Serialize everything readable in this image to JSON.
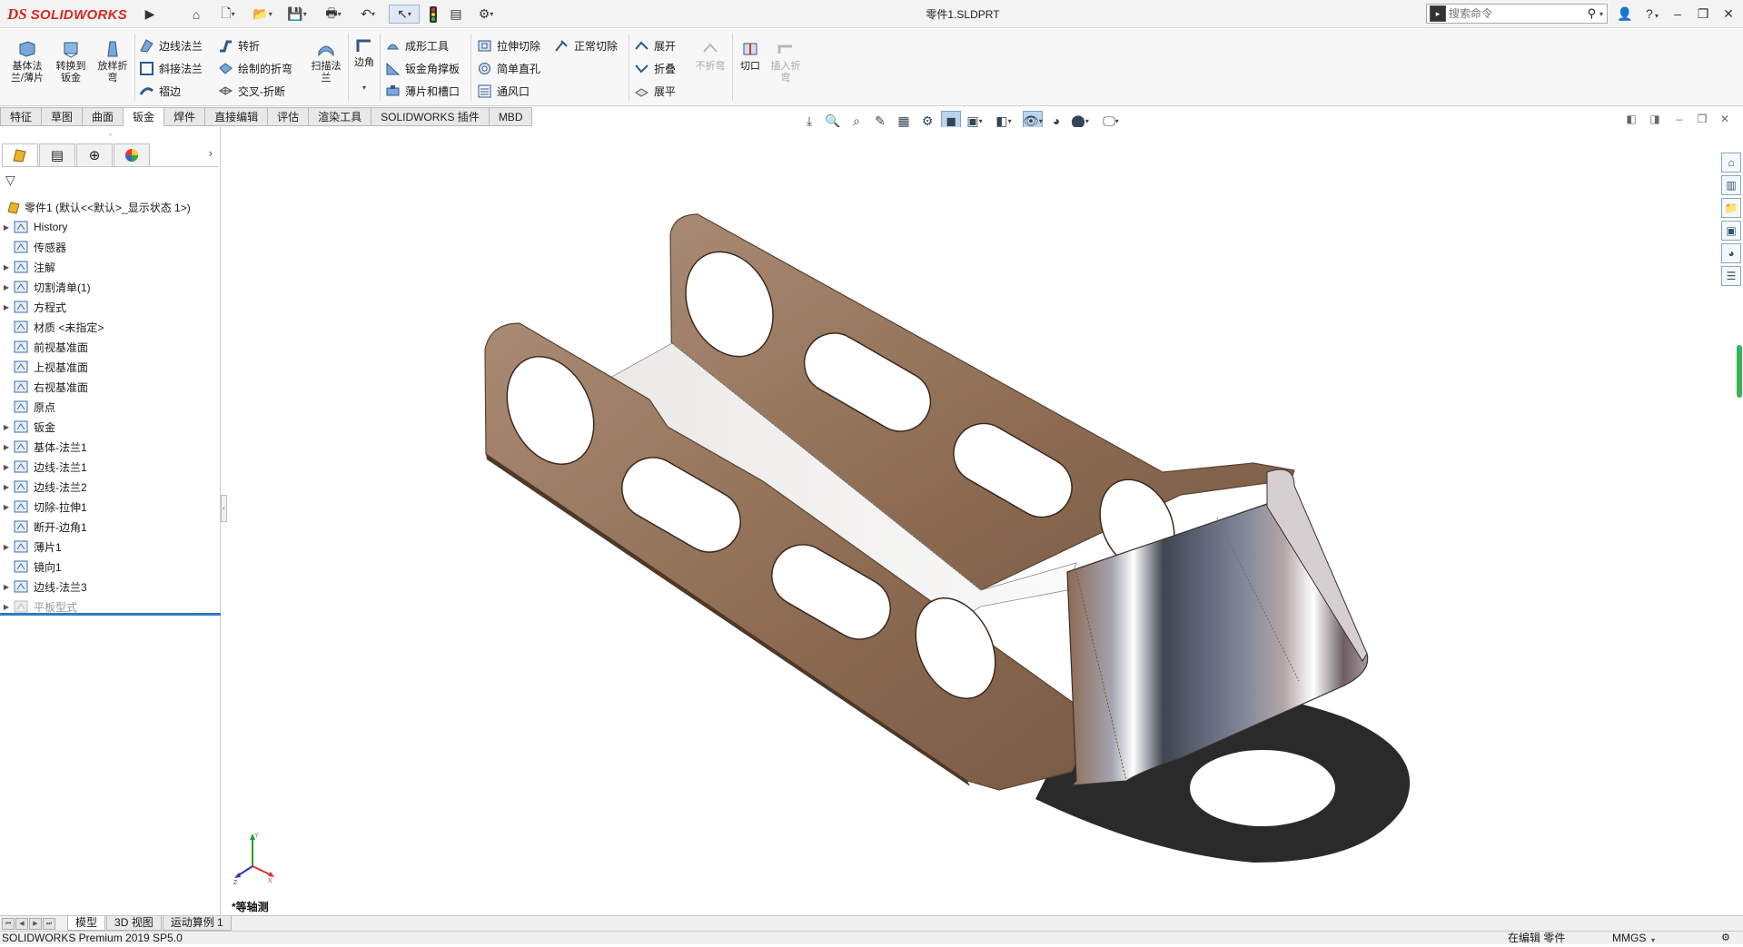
{
  "app": {
    "brand_ds": "DS",
    "brand_name": "SOLIDWORKS",
    "document_title": "零件1.SLDPRT",
    "search_placeholder": "搜索命令"
  },
  "ribbon": {
    "big_buttons": [
      {
        "label": "基体法\n兰/薄片",
        "icon": "base-flange-icon"
      },
      {
        "label": "转换到\n钣金",
        "icon": "convert-to-sheetmetal-icon"
      },
      {
        "label": "放样折\n弯",
        "icon": "lofted-bend-icon"
      }
    ],
    "col1": [
      "边线法兰",
      "斜接法兰",
      "褶边"
    ],
    "col2": [
      "转折",
      "绘制的折弯",
      "交叉-折断"
    ],
    "swept_flange": "扫描法\n兰",
    "corner": "边角",
    "col3": [
      "成形工具",
      "钣金角撑板",
      "薄片和槽口"
    ],
    "col4": [
      "拉伸切除",
      "简单直孔",
      "通风口"
    ],
    "normal_cut": "正常切除",
    "col5": [
      "展开",
      "折叠",
      "展平"
    ],
    "no_bends": "不折弯",
    "rip": "切口",
    "insert_bends": "插入折\n弯"
  },
  "tabs": [
    "特征",
    "草图",
    "曲面",
    "钣金",
    "焊件",
    "直接编辑",
    "评估",
    "渲染工具",
    "SOLIDWORKS 插件",
    "MBD"
  ],
  "active_tab_index": 3,
  "tree": {
    "root": "零件1 (默认<<默认>_显示状态 1>)",
    "items": [
      {
        "label": "History",
        "expandable": true,
        "icon": "history-icon"
      },
      {
        "label": "传感器",
        "expandable": false,
        "icon": "sensor-icon"
      },
      {
        "label": "注解",
        "expandable": true,
        "icon": "annotation-icon"
      },
      {
        "label": "切割清单(1)",
        "expandable": true,
        "icon": "cut-list-icon"
      },
      {
        "label": "方程式",
        "expandable": true,
        "icon": "equation-icon"
      },
      {
        "label": "材质 <未指定>",
        "expandable": false,
        "icon": "material-icon"
      },
      {
        "label": "前视基准面",
        "expandable": false,
        "icon": "plane-icon"
      },
      {
        "label": "上视基准面",
        "expandable": false,
        "icon": "plane-icon"
      },
      {
        "label": "右视基准面",
        "expandable": false,
        "icon": "plane-icon"
      },
      {
        "label": "原点",
        "expandable": false,
        "icon": "origin-icon"
      },
      {
        "label": "钣金",
        "expandable": true,
        "icon": "sheetmetal-folder-icon"
      },
      {
        "label": "基体-法兰1",
        "expandable": true,
        "icon": "flange-feature-icon"
      },
      {
        "label": "边线-法兰1",
        "expandable": true,
        "icon": "edge-flange-icon"
      },
      {
        "label": "边线-法兰2",
        "expandable": true,
        "icon": "edge-flange-icon"
      },
      {
        "label": "切除-拉伸1",
        "expandable": true,
        "icon": "cut-extrude-icon"
      },
      {
        "label": "断开-边角1",
        "expandable": false,
        "icon": "break-corner-icon"
      },
      {
        "label": "薄片1",
        "expandable": true,
        "icon": "tab-feature-icon"
      },
      {
        "label": "镜向1",
        "expandable": false,
        "icon": "mirror-icon"
      },
      {
        "label": "边线-法兰3",
        "expandable": true,
        "icon": "edge-flange-icon"
      },
      {
        "label": "平板型式",
        "expandable": true,
        "icon": "flat-pattern-icon",
        "greyed": true
      }
    ]
  },
  "viewport": {
    "view_name": "*等轴测",
    "triad": {
      "x": "X",
      "y": "Y",
      "z": "Z"
    }
  },
  "bottom_tabs": [
    "模型",
    "3D 视图",
    "运动算例 1"
  ],
  "active_bottom_tab": 0,
  "status": {
    "app_version": "SOLIDWORKS Premium 2019 SP5.0",
    "editing": "在编辑 零件",
    "units": "MMGS"
  },
  "colors": {
    "part_tan": "#8c6a52",
    "part_highlight": "#a98a72",
    "selection_blue": "#2d7bc5",
    "brand_red": "#d52a1d"
  }
}
